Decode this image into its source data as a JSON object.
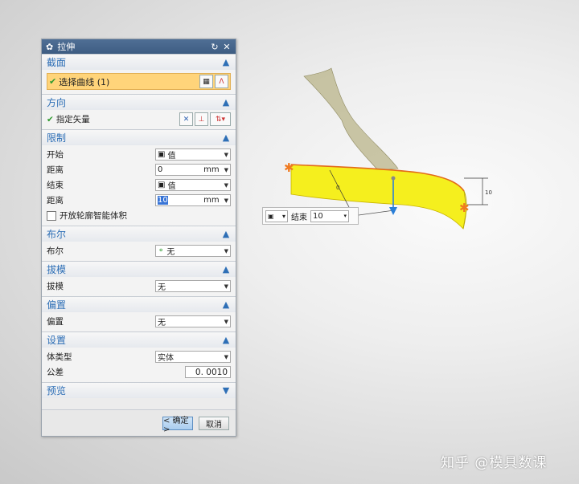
{
  "dialog": {
    "title": "拉伸",
    "sections": {
      "section": {
        "label": "截面",
        "select_curve": "选择曲线 (1)"
      },
      "direction": {
        "label": "方向",
        "specify_vector": "指定矢量"
      },
      "limits": {
        "label": "限制",
        "start_label": "开始",
        "start_value": "值",
        "start_distance_label": "距离",
        "start_distance_value": "0",
        "start_distance_unit": "mm",
        "end_label": "结束",
        "end_value": "值",
        "end_distance_label": "距离",
        "end_distance_value": "10",
        "end_distance_unit": "mm",
        "open_profile_label": "开放轮廓智能体积"
      },
      "boolean": {
        "label": "布尔",
        "row_label": "布尔",
        "value": "无"
      },
      "draft": {
        "label": "拔模",
        "row_label": "拔模",
        "value": "无"
      },
      "offset": {
        "label": "偏置",
        "row_label": "偏置",
        "value": "无"
      },
      "settings": {
        "label": "设置",
        "body_type_label": "体类型",
        "body_type_value": "实体",
        "tolerance_label": "公差",
        "tolerance_value": "0. 0010"
      },
      "preview": {
        "label": "预览"
      }
    },
    "ok_label": "< 确定 >",
    "cancel_label": "取消"
  },
  "floating_toolbar": {
    "end_label": "结束",
    "end_value": "10"
  },
  "watermark": "知乎 @模具数课",
  "colors": {
    "surface": "#f5ef1e",
    "section_header_text": "#2e6fb6",
    "selection_highlight": "#ffd47a"
  }
}
